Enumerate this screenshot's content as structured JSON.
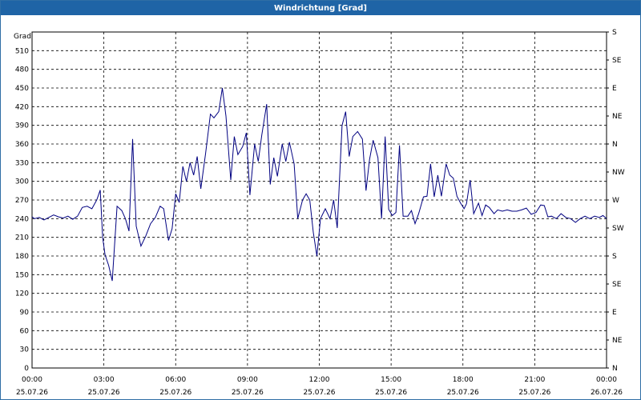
{
  "window": {
    "title": "Windrichtung [Grad]"
  },
  "chart_data": {
    "type": "line",
    "title": "Windrichtung [Grad]",
    "ylabel": "Grad",
    "ylim": [
      0,
      540
    ],
    "y_ticks": [
      0,
      30,
      60,
      90,
      120,
      150,
      180,
      210,
      240,
      270,
      300,
      330,
      360,
      390,
      420,
      450,
      480,
      510
    ],
    "right_ticks": [
      {
        "value": 0,
        "label": "N"
      },
      {
        "value": 45,
        "label": "NE"
      },
      {
        "value": 90,
        "label": "E"
      },
      {
        "value": 135,
        "label": "SE"
      },
      {
        "value": 180,
        "label": "S"
      },
      {
        "value": 225,
        "label": "SW"
      },
      {
        "value": 270,
        "label": "W"
      },
      {
        "value": 315,
        "label": "NW"
      },
      {
        "value": 360,
        "label": "N"
      },
      {
        "value": 405,
        "label": "NE"
      },
      {
        "value": 450,
        "label": "E"
      },
      {
        "value": 495,
        "label": "SE"
      },
      {
        "value": 540,
        "label": "S"
      }
    ],
    "xlim": [
      0,
      24
    ],
    "x_ticks": [
      {
        "h": 0,
        "time": "00:00",
        "date": "25.07.26"
      },
      {
        "h": 3,
        "time": "03:00",
        "date": "25.07.26"
      },
      {
        "h": 6,
        "time": "06:00",
        "date": "25.07.26"
      },
      {
        "h": 9,
        "time": "09:00",
        "date": "25.07.26"
      },
      {
        "h": 12,
        "time": "12:00",
        "date": "25.07.26"
      },
      {
        "h": 15,
        "time": "15:00",
        "date": "25.07.26"
      },
      {
        "h": 18,
        "time": "18:00",
        "date": "25.07.26"
      },
      {
        "h": 21,
        "time": "21:00",
        "date": "25.07.26"
      },
      {
        "h": 24,
        "time": "00:00",
        "date": "26.07.26"
      }
    ],
    "grid": true,
    "colors": {
      "line": "#000080",
      "grid": "#000000",
      "title_bar": "#1f64a6"
    },
    "series": [
      {
        "name": "",
        "points": [
          [
            0.0,
            243
          ],
          [
            0.1,
            240
          ],
          [
            0.3,
            242
          ],
          [
            0.5,
            238
          ],
          [
            0.7,
            242
          ],
          [
            0.9,
            246
          ],
          [
            1.1,
            243
          ],
          [
            1.3,
            241
          ],
          [
            1.5,
            244
          ],
          [
            1.7,
            239
          ],
          [
            1.9,
            244
          ],
          [
            2.1,
            258
          ],
          [
            2.3,
            260
          ],
          [
            2.5,
            256
          ],
          [
            2.7,
            270
          ],
          [
            2.85,
            286
          ],
          [
            2.95,
            210
          ],
          [
            3.05,
            182
          ],
          [
            3.2,
            165
          ],
          [
            3.35,
            140
          ],
          [
            3.55,
            260
          ],
          [
            3.75,
            253
          ],
          [
            3.9,
            240
          ],
          [
            4.05,
            220
          ],
          [
            4.2,
            368
          ],
          [
            4.35,
            228
          ],
          [
            4.55,
            196
          ],
          [
            4.75,
            212
          ],
          [
            4.95,
            232
          ],
          [
            5.15,
            242
          ],
          [
            5.35,
            260
          ],
          [
            5.5,
            256
          ],
          [
            5.7,
            205
          ],
          [
            5.85,
            224
          ],
          [
            6.0,
            280
          ],
          [
            6.15,
            266
          ],
          [
            6.3,
            324
          ],
          [
            6.45,
            300
          ],
          [
            6.6,
            330
          ],
          [
            6.75,
            310
          ],
          [
            6.9,
            340
          ],
          [
            7.05,
            288
          ],
          [
            7.25,
            345
          ],
          [
            7.45,
            408
          ],
          [
            7.6,
            402
          ],
          [
            7.8,
            412
          ],
          [
            7.95,
            450
          ],
          [
            8.1,
            405
          ],
          [
            8.3,
            302
          ],
          [
            8.45,
            372
          ],
          [
            8.6,
            343
          ],
          [
            8.8,
            356
          ],
          [
            8.95,
            378
          ],
          [
            9.1,
            278
          ],
          [
            9.3,
            360
          ],
          [
            9.45,
            332
          ],
          [
            9.6,
            375
          ],
          [
            9.8,
            424
          ],
          [
            9.95,
            295
          ],
          [
            10.1,
            338
          ],
          [
            10.25,
            308
          ],
          [
            10.45,
            360
          ],
          [
            10.6,
            332
          ],
          [
            10.75,
            363
          ],
          [
            10.95,
            328
          ],
          [
            11.1,
            240
          ],
          [
            11.3,
            270
          ],
          [
            11.45,
            280
          ],
          [
            11.6,
            270
          ],
          [
            11.75,
            218
          ],
          [
            11.9,
            180
          ],
          [
            12.05,
            240
          ],
          [
            12.25,
            256
          ],
          [
            12.45,
            240
          ],
          [
            12.6,
            270
          ],
          [
            12.75,
            225
          ],
          [
            12.95,
            390
          ],
          [
            13.1,
            412
          ],
          [
            13.25,
            340
          ],
          [
            13.4,
            372
          ],
          [
            13.6,
            380
          ],
          [
            13.8,
            368
          ],
          [
            13.95,
            285
          ],
          [
            14.1,
            335
          ],
          [
            14.25,
            366
          ],
          [
            14.45,
            338
          ],
          [
            14.6,
            240
          ],
          [
            14.75,
            372
          ],
          [
            14.9,
            255
          ],
          [
            15.05,
            245
          ],
          [
            15.2,
            250
          ],
          [
            15.35,
            358
          ],
          [
            15.5,
            244
          ],
          [
            15.7,
            244
          ],
          [
            15.85,
            253
          ],
          [
            16.0,
            232
          ],
          [
            16.15,
            248
          ],
          [
            16.35,
            275
          ],
          [
            16.5,
            276
          ],
          [
            16.65,
            328
          ],
          [
            16.8,
            275
          ],
          [
            16.95,
            310
          ],
          [
            17.1,
            276
          ],
          [
            17.3,
            328
          ],
          [
            17.45,
            310
          ],
          [
            17.6,
            305
          ],
          [
            17.75,
            276
          ],
          [
            17.9,
            265
          ],
          [
            18.05,
            256
          ],
          [
            18.15,
            264
          ],
          [
            18.3,
            302
          ],
          [
            18.45,
            248
          ],
          [
            18.65,
            265
          ],
          [
            18.8,
            245
          ],
          [
            18.95,
            262
          ],
          [
            19.1,
            258
          ],
          [
            19.3,
            248
          ],
          [
            19.45,
            254
          ],
          [
            19.65,
            252
          ],
          [
            19.85,
            254
          ],
          [
            20.05,
            252
          ],
          [
            20.25,
            252
          ],
          [
            20.45,
            254
          ],
          [
            20.65,
            257
          ],
          [
            20.85,
            247
          ],
          [
            21.05,
            250
          ],
          [
            21.25,
            262
          ],
          [
            21.4,
            261
          ],
          [
            21.55,
            243
          ],
          [
            21.7,
            244
          ],
          [
            21.9,
            240
          ],
          [
            22.1,
            248
          ],
          [
            22.3,
            242
          ],
          [
            22.5,
            240
          ],
          [
            22.7,
            234
          ],
          [
            22.9,
            240
          ],
          [
            23.1,
            244
          ],
          [
            23.3,
            240
          ],
          [
            23.5,
            244
          ],
          [
            23.7,
            242
          ],
          [
            23.85,
            245
          ],
          [
            24.0,
            240
          ]
        ]
      }
    ]
  }
}
